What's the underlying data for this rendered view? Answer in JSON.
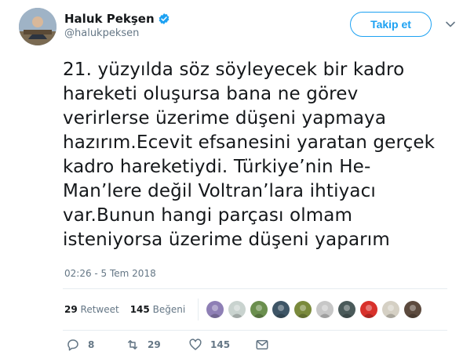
{
  "user": {
    "display_name": "Haluk Pekşen",
    "handle": "@halukpeksen",
    "verified": true
  },
  "follow_button": {
    "label": "Takip et"
  },
  "tweet": {
    "text": "21. yüzyılda söz söyleyecek bir kadro\nhareketi oluşursa bana ne görev\nverirlerse üzerime düşeni yapmaya\nhazırım.Ecevit efsanesini yaratan gerçek\nkadro hareketiydi. Türkiye’nin He-\nMan’lere değil Voltran’lara ihtiyacı\nvar.Bunun hangi parçası olmam\nisteniyorsa üzerime düşeni yaparım",
    "timestamp": "02:26 - 5 Tem 2018"
  },
  "stats": {
    "retweets_count": "29",
    "retweets_label": "Retweet",
    "likes_count": "145",
    "likes_label": "Beğeni"
  },
  "likers": [
    {
      "name": "liker-avatar-1",
      "color": "#8e7fb5"
    },
    {
      "name": "liker-avatar-2",
      "color": "#c9d3cf"
    },
    {
      "name": "liker-avatar-3",
      "color": "#6b8f4e"
    },
    {
      "name": "liker-avatar-4",
      "color": "#3e5566"
    },
    {
      "name": "liker-avatar-5",
      "color": "#7a8a3c"
    },
    {
      "name": "liker-avatar-6",
      "color": "#c7c7c7"
    },
    {
      "name": "liker-avatar-7",
      "color": "#4a5a5a"
    },
    {
      "name": "liker-avatar-8",
      "color": "#d8312b"
    },
    {
      "name": "liker-avatar-9",
      "color": "#d5d0c4"
    },
    {
      "name": "liker-avatar-10",
      "color": "#5c4a3e"
    }
  ],
  "actions": {
    "replies": "8",
    "retweets": "29",
    "likes": "145"
  },
  "colors": {
    "accent": "#1da1f2",
    "text": "#14171a",
    "secondary": "#657786"
  }
}
